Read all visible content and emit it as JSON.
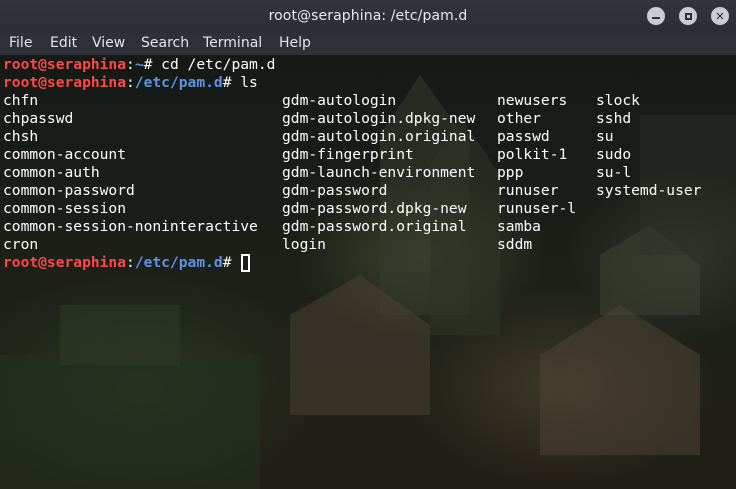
{
  "window": {
    "title": "root@seraphina: /etc/pam.d",
    "controls": [
      "minimize-icon",
      "maximize-icon",
      "close-icon"
    ]
  },
  "menu": [
    "File",
    "Edit",
    "View",
    "Search",
    "Terminal",
    "Help"
  ],
  "terminal": {
    "line1": {
      "user": "root@seraphina",
      "sep": ":",
      "cwd": "~",
      "suffix": "# cd /etc/pam.d"
    },
    "line2": {
      "user": "root@seraphina",
      "sep": ":",
      "cwd": "/etc/pam.d",
      "suffix": "# ls"
    },
    "rows": [
      [
        "chfn",
        "gdm-autologin",
        "newusers",
        "slock"
      ],
      [
        "chpasswd",
        "gdm-autologin.dpkg-new",
        "other",
        "sshd"
      ],
      [
        "chsh",
        "gdm-autologin.original",
        "passwd",
        "su"
      ],
      [
        "common-account",
        "gdm-fingerprint",
        "polkit-1",
        "sudo"
      ],
      [
        "common-auth",
        "gdm-launch-environment",
        "ppp",
        "su-l"
      ],
      [
        "common-password",
        "gdm-password",
        "runuser",
        "systemd-user"
      ],
      [
        "common-session",
        "gdm-password.dpkg-new",
        "runuser-l",
        ""
      ],
      [
        "common-session-noninteractive",
        "gdm-password.original",
        "samba",
        ""
      ],
      [
        "cron",
        "login",
        "sddm",
        ""
      ]
    ],
    "prompt": {
      "user": "root@seraphina",
      "sep": ":",
      "cwd": "/etc/pam.d",
      "suffix": "# "
    }
  },
  "colors": {
    "prompt_user": "#ff4747",
    "prompt_path": "#5d93e6",
    "text": "#ffffff"
  }
}
